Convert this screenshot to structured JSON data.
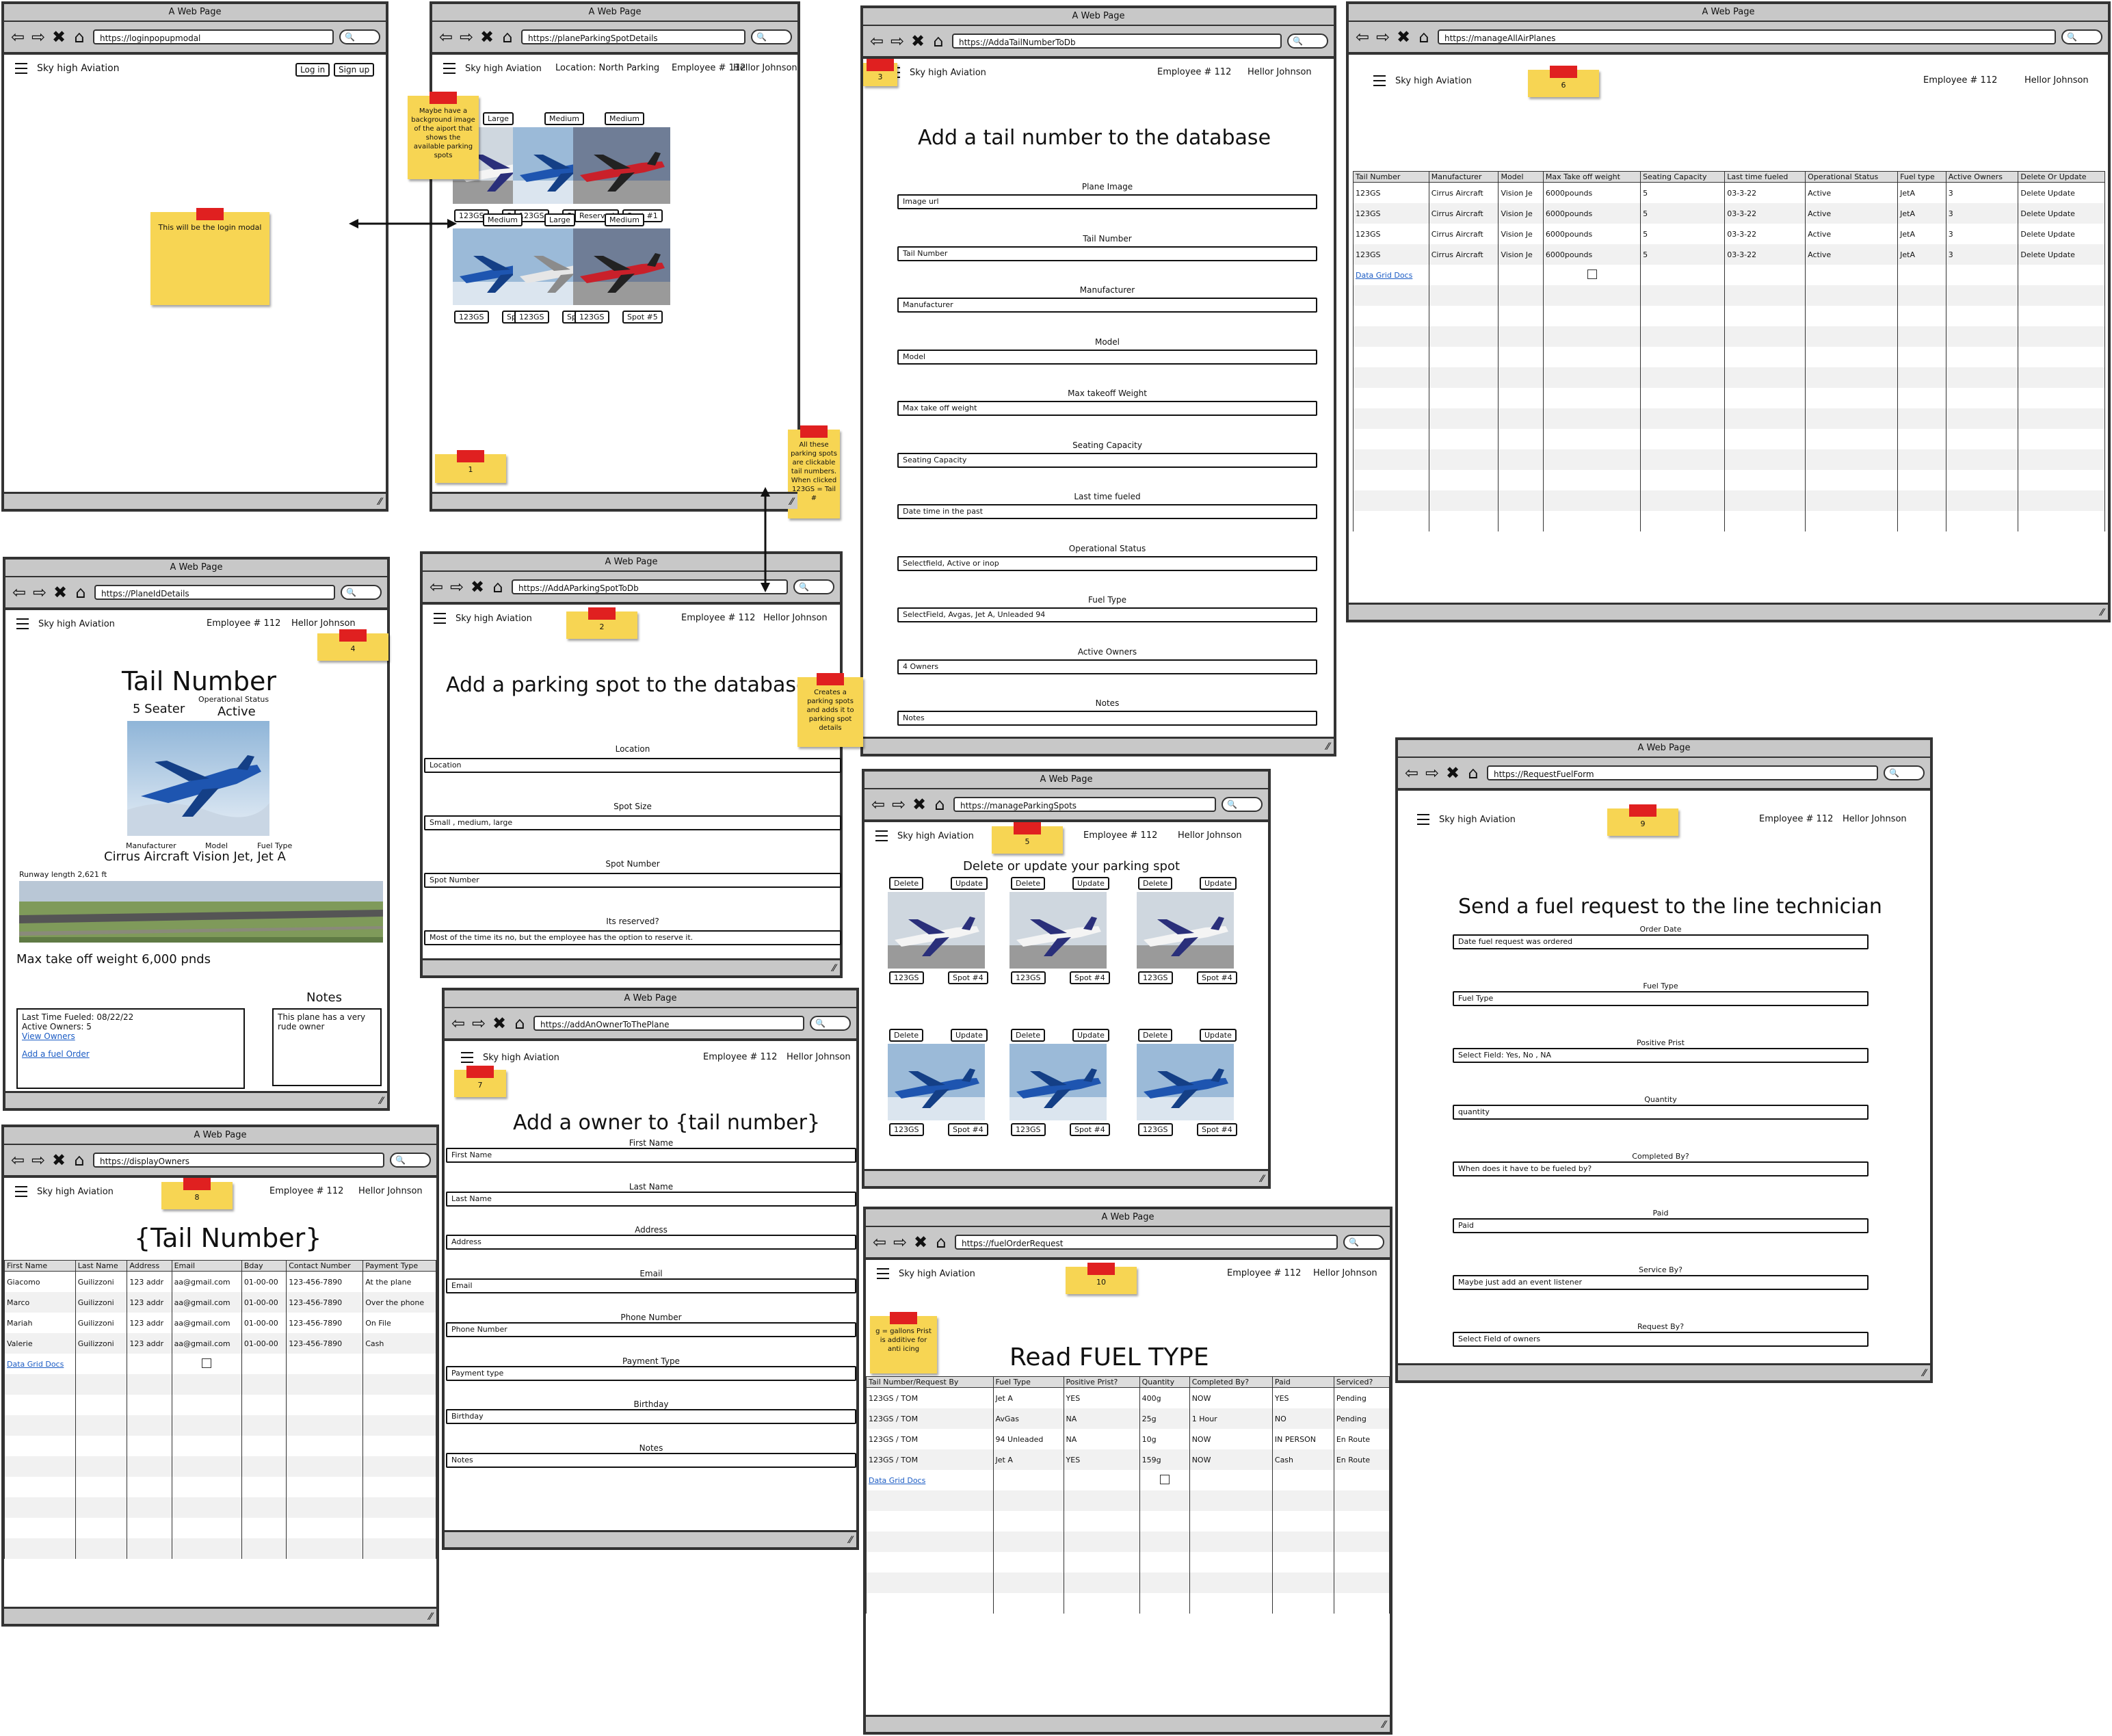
{
  "common": {
    "window_title": "A Web Page",
    "brand": "Sky high Aviation",
    "employee": "Employee # 112",
    "user": "Hellor Johnson",
    "data_grid_docs": "Data Grid Docs",
    "grip": "////"
  },
  "w1": {
    "url": "https://loginpopupmodal",
    "login": "Log in",
    "signup": "Sign up",
    "note": "This will be the login modal"
  },
  "w2": {
    "url": "https://planeParkingSpotDetails",
    "location": "Location: North Parking",
    "note_bg": "Maybe have a background image of the aiport that shows the available parking spots",
    "note_num": "1",
    "note_click": "All these parking spots are clickable tail numbers. When clicked 123GS = Tail #",
    "spots": [
      {
        "size": "Large",
        "tail": "123GS",
        "spot": "Spot #10",
        "img": "white-jet"
      },
      {
        "size": "Medium",
        "tail": "123GS",
        "spot": "Spot #2",
        "img": "blue-jet"
      },
      {
        "size": "Medium",
        "tail": "Reserved",
        "spot": "Spot #1",
        "img": "red-jet"
      },
      {
        "size": "Medium",
        "tail": "123GS",
        "spot": "Spot #3",
        "img": "blue-jet"
      },
      {
        "size": "Large",
        "tail": "123GS",
        "spot": "Spot #4",
        "img": "silver-jet"
      },
      {
        "size": "Medium",
        "tail": "123GS",
        "spot": "Spot #5",
        "img": "red-jet"
      }
    ]
  },
  "w3": {
    "url": "https://AddaTailNumberToDb",
    "note_num": "3",
    "title": "Add a tail number to the database",
    "fields": [
      {
        "label": "Plane Image",
        "value": "Image url"
      },
      {
        "label": "Tail Number",
        "value": "Tail Number"
      },
      {
        "label": "Manufacturer",
        "value": "Manufacturer"
      },
      {
        "label": "Model",
        "value": "Model"
      },
      {
        "label": "Max takeoff Weight",
        "value": "Max take off weight"
      },
      {
        "label": "Seating Capacity",
        "value": "Seating Capacity"
      },
      {
        "label": "Last time fueled",
        "value": "Date time in the past"
      },
      {
        "label": "Operational Status",
        "value": "Selectfield, Active or inop"
      },
      {
        "label": "Fuel Type",
        "value": "SelectField, Avgas, Jet A, Unleaded 94"
      },
      {
        "label": "Active Owners",
        "value": "4 Owners"
      },
      {
        "label": "Notes",
        "value": "Notes"
      }
    ]
  },
  "w4": {
    "url": "https://manageAllAirPlanes",
    "note_num": "6",
    "columns": [
      "Tail Number",
      "Manufacturer",
      "Model",
      "Max Take off weight",
      "Seating Capacity",
      "Last time fueled",
      "Operational Status",
      "Fuel type",
      "Active Owners",
      "Delete Or Update"
    ],
    "rows": [
      [
        "123GS",
        "Cirrus Aircraft",
        "Vision Je",
        "6000pounds",
        "5",
        "03-3-22",
        "Active",
        "JetA",
        "3",
        "Delete  Update"
      ],
      [
        "123GS",
        "Cirrus Aircraft",
        "Vision Je",
        "6000pounds",
        "5",
        "03-3-22",
        "Active",
        "JetA",
        "3",
        "Delete  Update"
      ],
      [
        "123GS",
        "Cirrus Aircraft",
        "Vision Je",
        "6000pounds",
        "5",
        "03-3-22",
        "Active",
        "JetA",
        "3",
        "Delete  Update"
      ],
      [
        "123GS",
        "Cirrus Aircraft",
        "Vision Je",
        "6000pounds",
        "5",
        "03-3-22",
        "Active",
        "JetA",
        "3",
        "Delete  Update"
      ]
    ]
  },
  "w5": {
    "url": "https://PlaneIdDetails",
    "note_num": "4",
    "title": "Tail Number",
    "seater": "5 Seater",
    "op_status_label": "Operational Status",
    "op_status": "Active",
    "manufacturer_label": "Manufacturer",
    "model_label": "Model",
    "fuel_label": "Fuel Type",
    "aircraft": "Cirrus Aircraft Vision Jet, Jet A",
    "runway": "Runway length 2,621 ft",
    "weight": "Max take off weight 6,000 pnds",
    "notes_title": "Notes",
    "last_fueled": "Last Time Fueled: 08/22/22",
    "owners_count": "Active Owners: 5",
    "view_owners": "View Owners",
    "add_fuel": "Add a fuel Order",
    "notes_text": "This plane has a very rude owner"
  },
  "w6": {
    "url": "https://AddAParkingSpotToDb",
    "note_num": "2",
    "title": "Add a parking spot to the database",
    "note": "Creates a parking spots and adds it to parking spot details",
    "fields": [
      {
        "label": "Location",
        "value": "Location"
      },
      {
        "label": "Spot Size",
        "value": "Small , medium, large"
      },
      {
        "label": "Spot Number",
        "value": "Spot Number"
      },
      {
        "label": "Its reserved?",
        "value": "Most of the time its no, but the employee has the option to reserve it."
      }
    ]
  },
  "w7": {
    "url": "https://manageParkingSpots",
    "note_num": "5",
    "title": "Delete or update your parking spot",
    "delete": "Delete",
    "update": "Update",
    "cards": [
      {
        "tail": "123GS",
        "spot": "Spot #4",
        "img": "white-jet"
      },
      {
        "tail": "123GS",
        "spot": "Spot #4",
        "img": "white-jet"
      },
      {
        "tail": "123GS",
        "spot": "Spot #4",
        "img": "white-jet"
      },
      {
        "tail": "123GS",
        "spot": "Spot #4",
        "img": "blue-jet"
      },
      {
        "tail": "123GS",
        "spot": "Spot #4",
        "img": "blue-jet"
      },
      {
        "tail": "123GS",
        "spot": "Spot #4",
        "img": "blue-jet"
      }
    ]
  },
  "w8": {
    "url": "https://RequestFuelForm",
    "note_num": "9",
    "title": "Send a fuel request to the line technician",
    "fields": [
      {
        "label": "Order Date",
        "value": "Date fuel request was ordered"
      },
      {
        "label": "Fuel Type",
        "value": "Fuel Type"
      },
      {
        "label": "Positive Prist",
        "value": "Select Field: Yes, No , NA"
      },
      {
        "label": "Quantity",
        "value": "quantity"
      },
      {
        "label": "Completed By?",
        "value": "When does it have to be fueled by?"
      },
      {
        "label": "Paid",
        "value": "Paid"
      },
      {
        "label": "Service By?",
        "value": "Maybe just add an event listener"
      },
      {
        "label": "Request By?",
        "value": "Select Field of owners"
      }
    ]
  },
  "w9": {
    "url": "https://displayOwners",
    "note_num": "8",
    "title": "{Tail Number}",
    "columns": [
      "First Name",
      "Last Name",
      "Address",
      "Email",
      "Bday",
      "Contact Number",
      "Payment Type"
    ],
    "rows": [
      [
        "Giacomo",
        "Guilizzoni",
        "123 addr",
        "aa@gmail.com",
        "01-00-00",
        "123-456-7890",
        "At the plane"
      ],
      [
        "Marco",
        "Guilizzoni",
        "123 addr",
        "aa@gmail.com",
        "01-00-00",
        "123-456-7890",
        "Over the phone"
      ],
      [
        "Mariah",
        "Guilizzoni",
        "123 addr",
        "aa@gmail.com",
        "01-00-00",
        "123-456-7890",
        "On File"
      ],
      [
        "Valerie",
        "Guilizzoni",
        "123 addr",
        "aa@gmail.com",
        "01-00-00",
        "123-456-7890",
        "Cash"
      ]
    ]
  },
  "w10": {
    "url": "https://addAnOwnerToThePlane",
    "note_num": "7",
    "title": "Add a owner to {tail number}",
    "fields": [
      {
        "label": "First Name",
        "value": "First Name"
      },
      {
        "label": "Last Name",
        "value": "Last Name"
      },
      {
        "label": "Address",
        "value": "Address"
      },
      {
        "label": "Email",
        "value": "Email"
      },
      {
        "label": "Phone Number",
        "value": "Phone Number"
      },
      {
        "label": "Payment Type",
        "value": "Payment type"
      },
      {
        "label": "Birthday",
        "value": "Birthday"
      },
      {
        "label": "Notes",
        "value": "Notes"
      }
    ]
  },
  "w11": {
    "url": "https://fuelOrderRequest",
    "note_num": "10",
    "note": "g = gallons Prist is additive for anti icing",
    "title": "Read FUEL TYPE",
    "columns": [
      "Tail Number/Request By",
      "Fuel Type",
      "Positive Prist?",
      "Quantity",
      "Completed By?",
      "Paid",
      "Serviced?"
    ],
    "rows": [
      [
        "123GS / TOM",
        "Jet A",
        "YES",
        "400g",
        "NOW",
        "YES",
        "Pending"
      ],
      [
        "123GS / TOM",
        "AvGas",
        "NA",
        "25g",
        "1 Hour",
        "NO",
        "Pending"
      ],
      [
        "123GS / TOM",
        "94 Unleaded",
        "NA",
        "10g",
        "NOW",
        "IN PERSON",
        "En Route"
      ],
      [
        "123GS / TOM",
        "Jet A",
        "YES",
        "159g",
        "NOW",
        "Cash",
        "En Route"
      ]
    ]
  }
}
